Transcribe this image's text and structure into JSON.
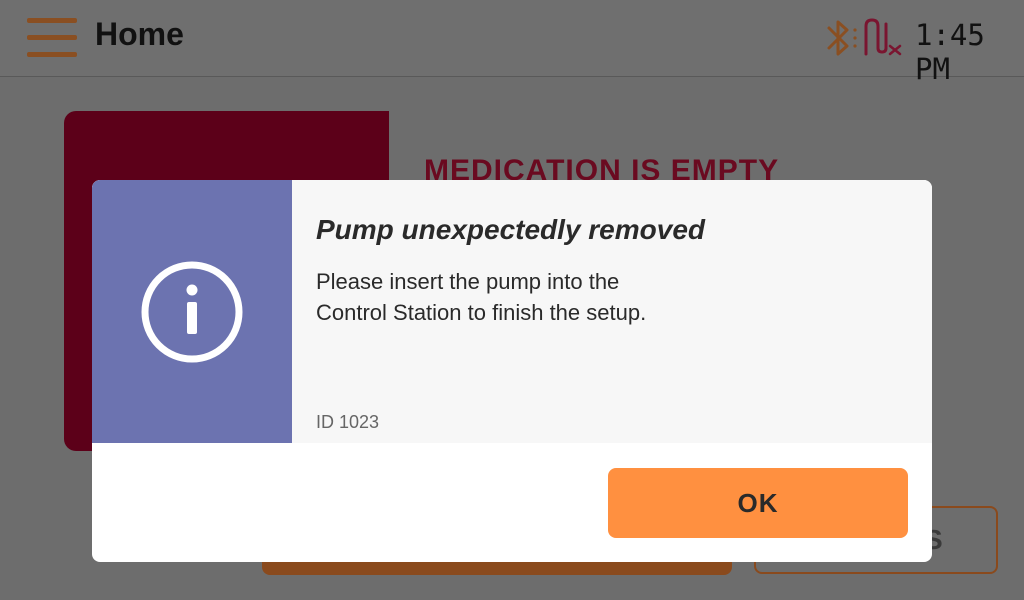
{
  "header": {
    "title": "Home",
    "time": "1:45 PM",
    "icons": {
      "menu": "hamburger-menu-icon",
      "bluetooth": "bluetooth-icon",
      "pump_status": "pump-disconnected-icon"
    }
  },
  "background": {
    "status_text": "MEDICATION IS EMPTY",
    "secondary_button_partial": "S"
  },
  "dialog": {
    "title": "Pump unexpectedly removed",
    "message_line1": "Please insert the pump into the",
    "message_line2": "Control Station to finish the setup.",
    "id_label": "ID 1023",
    "ok_label": "OK",
    "icon": "info-icon"
  },
  "colors": {
    "accent_orange": "#ff9040",
    "dialog_side": "#6c73b0",
    "alert_red": "#5c0019",
    "menu_brown": "#8a4f22"
  }
}
